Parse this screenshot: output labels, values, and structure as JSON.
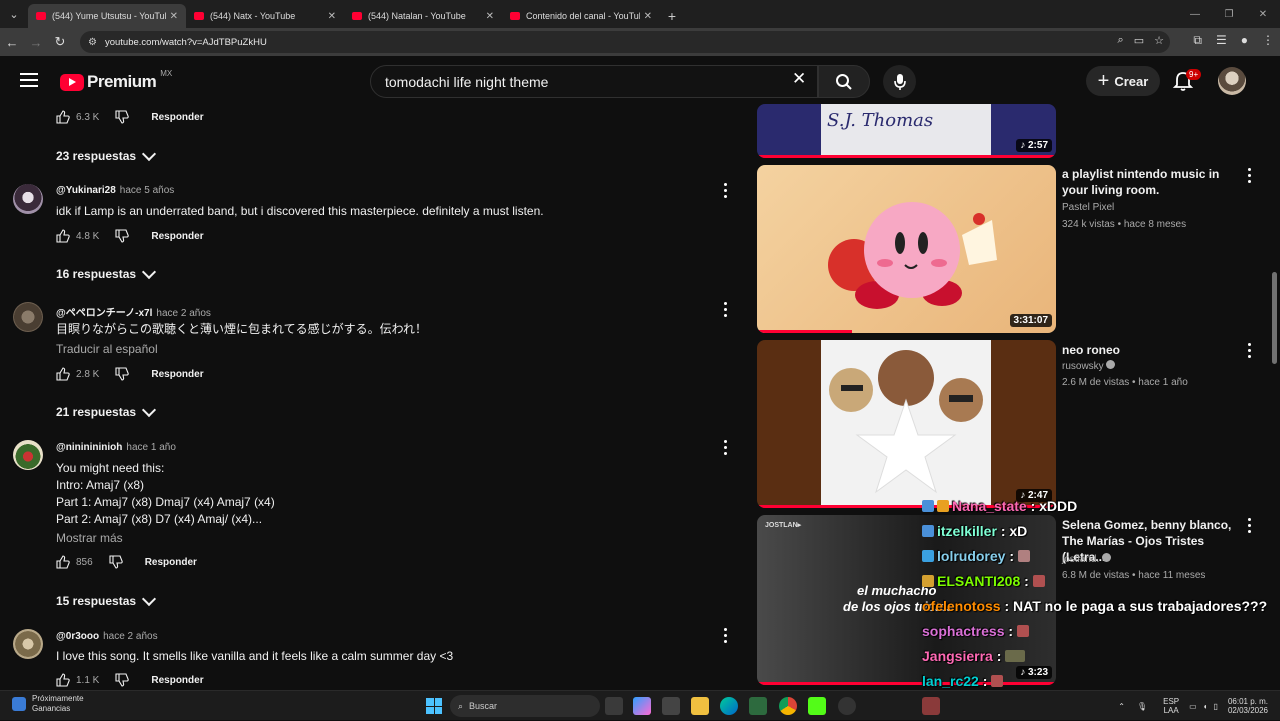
{
  "browser": {
    "tabs": [
      {
        "label": "(544) Yume Utsutsu - YouTube",
        "active": true
      },
      {
        "label": "(544) Natx - YouTube",
        "active": false
      },
      {
        "label": "(544) Natalan - YouTube",
        "active": false
      },
      {
        "label": "Contenido del canal - YouTube",
        "active": false
      }
    ],
    "url": "youtube.com/watch?v=AJdTBPuZkHU"
  },
  "header": {
    "logo_text": "Premium",
    "country": "MX",
    "search_value": "tomodachi life night theme",
    "create_label": "Crear",
    "notifications_badge": "9+"
  },
  "comments": {
    "top_actions": {
      "likes": "6.3 K",
      "reply_label": "Responder"
    },
    "top_replies": "23 respuestas",
    "items": [
      {
        "author": "@Yukinari28",
        "time": "hace 5 años",
        "text": "idk if Lamp is an underrated band, but i discovered this masterpiece. definitely a must listen.",
        "likes": "4.8 K",
        "reply_label": "Responder",
        "replies": "16 respuestas"
      },
      {
        "author": "@ペペロンチーノ-x7l",
        "time": "hace 2 años",
        "text": "目瞑りながらこの歌聴くと薄い煙に包まれてる感じがする。伝われ！",
        "translate": "Traducir al español",
        "likes": "2.8 K",
        "reply_label": "Responder",
        "replies": "21 respuestas"
      },
      {
        "author": "@nininininioh",
        "time": "hace 1 año",
        "lines": [
          "You might need this:",
          "Intro: Amaj7 (x8)",
          "Part 1: Amaj7 (x8) Dmaj7 (x4) Amaj7 (x4)",
          "Part 2: Amaj7 (x8) D7 (x4) Amaj/ (x4)..."
        ],
        "more": "Mostrar más",
        "likes": "856",
        "reply_label": "Responder",
        "replies": "15 respuestas"
      },
      {
        "author": "@0r3ooo",
        "time": "hace 2 años",
        "text": "I love this song. It smells like vanilla and it feels like a calm summer day <3",
        "likes": "1.1 K",
        "reply_label": "Responder"
      }
    ]
  },
  "sidebar": {
    "videos": [
      {
        "thumb_text": "S.J. Thomas",
        "duration": "2:57"
      },
      {
        "title": "a playlist nintendo music in your living room.",
        "channel": "Pastel Pixel",
        "meta": "324 k vistas • hace 8 meses",
        "duration": "3:31:07"
      },
      {
        "title": "neo roneo",
        "channel": "rusowsky",
        "meta": "2.6 M de vistas • hace 1 año",
        "duration": "2:47"
      },
      {
        "title": "Selena Gomez, benny blanco, The Marías - Ojos Tristes (Letra...",
        "channel": "jostland.",
        "meta": "6.8 M de vistas • hace 11 meses",
        "duration": "3:23",
        "thumb_brand": "JOSTLAN▸",
        "thumb_caption_1": "el muchacho",
        "thumb_caption_2": "de los ojos tristes"
      }
    ]
  },
  "chat": [
    {
      "user": "Nana_state",
      "msg": ": xDDD",
      "color": "#ff69b4"
    },
    {
      "user": "itzelkiller",
      "msg": ": xD",
      "color": "#7fffd4"
    },
    {
      "user": "lolrudorey",
      "msg": ":",
      "color": "#87ceeb"
    },
    {
      "user": "ELSANTI208",
      "msg": ":",
      "color": "#7cfc00"
    },
    {
      "user": "ofelenotoss",
      "msg": ": NAT no le paga a sus trabajadores???",
      "color": "#ff8c00"
    },
    {
      "user": "sophactress",
      "msg": ":",
      "color": "#da70d6"
    },
    {
      "user": "Jangsierra",
      "msg": ":",
      "color": "#ff69b4"
    },
    {
      "user": "lan_rc22",
      "msg": ":",
      "color": "#00ced1"
    }
  ],
  "taskbar": {
    "weather_title": "Próximamente",
    "weather_sub": "Ganancias",
    "search_placeholder": "Buscar",
    "lang_1": "ESP",
    "lang_2": "LAA",
    "time": "06:01 p. m.",
    "date": "02/03/2026"
  }
}
